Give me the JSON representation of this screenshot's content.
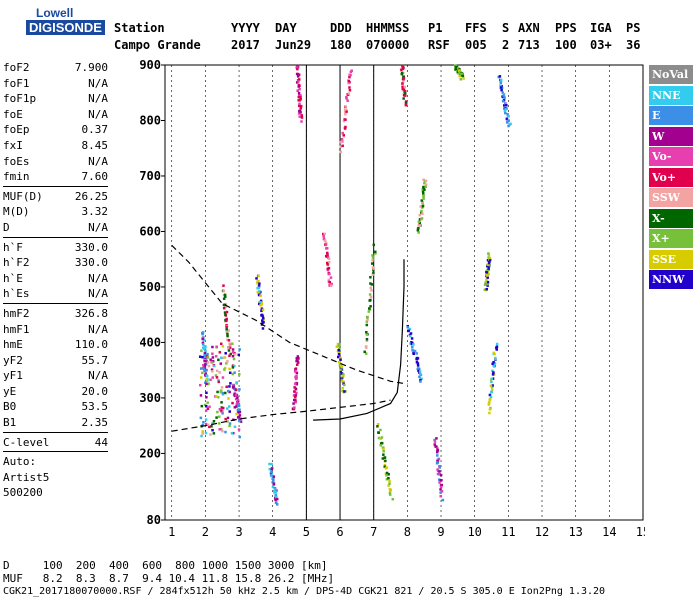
{
  "logo": {
    "line1": "Lowell",
    "line2": "DIGISONDE"
  },
  "header": {
    "row1": {
      "station": "Station",
      "yyyy": "YYYY",
      "day": "DAY",
      "ddd": "DDD",
      "hhmmss": "HHMMSS",
      "p1": "P1",
      "ffs": "FFS",
      "s": "S",
      "axn": "AXN",
      "pps": "PPS",
      "iga": "IGA",
      "ps": "PS"
    },
    "row2": {
      "station": "Campo Grande",
      "yyyy": "2017",
      "day": "Jun29",
      "ddd": "180",
      "hhmmss": "070000",
      "p1": "RSF",
      "ffs": "005",
      "s": "2",
      "axn": "713",
      "pps": "100",
      "iga": "03+",
      "ps": "36"
    }
  },
  "params": {
    "g1": [
      [
        "foF2",
        "7.900"
      ],
      [
        "foF1",
        "N/A"
      ],
      [
        "foF1p",
        "N/A"
      ],
      [
        "foE",
        "N/A"
      ],
      [
        "foEp",
        "0.37"
      ],
      [
        "fxI",
        "8.45"
      ],
      [
        "foEs",
        "N/A"
      ],
      [
        "fmin",
        "7.60"
      ]
    ],
    "g2": [
      [
        "MUF(D)",
        "26.25"
      ],
      [
        "M(D)",
        "3.32"
      ],
      [
        "D",
        "N/A"
      ]
    ],
    "g3": [
      [
        "h`F",
        "330.0"
      ],
      [
        "h`F2",
        "330.0"
      ],
      [
        "h`E",
        "N/A"
      ],
      [
        "h`Es",
        "N/A"
      ]
    ],
    "g4": [
      [
        "hmF2",
        "326.8"
      ],
      [
        "hmF1",
        "N/A"
      ],
      [
        "hmE",
        "110.0"
      ],
      [
        "yF2",
        "55.7"
      ],
      [
        "yF1",
        "N/A"
      ],
      [
        "yE",
        "20.0"
      ],
      [
        "B0",
        "53.5"
      ],
      [
        "B1",
        "2.35"
      ]
    ],
    "clevel": [
      "C-level",
      "44"
    ],
    "auto": [
      "Auto:",
      "Artist5",
      "500200"
    ]
  },
  "legend": [
    {
      "label": "NoVal",
      "color": "#8c8c8c"
    },
    {
      "label": "NNE",
      "color": "#33ccee"
    },
    {
      "label": "E",
      "color": "#3b8fe6"
    },
    {
      "label": "W",
      "color": "#a4008f"
    },
    {
      "label": "Vo-",
      "color": "#e83fb0"
    },
    {
      "label": "Vo+",
      "color": "#e0004d"
    },
    {
      "label": "SSW",
      "color": "#f4a3a3"
    },
    {
      "label": "X-",
      "color": "#006600"
    },
    {
      "label": "X+",
      "color": "#77c13a"
    },
    {
      "label": "SSE",
      "color": "#d6cc00"
    },
    {
      "label": "NNW",
      "color": "#2200cc"
    }
  ],
  "footer": {
    "row1": "D     100  200  400  600  800 1000 1500 3000 [km]",
    "row2": "MUF   8.2  8.3  8.7  9.4 10.4 11.8 15.8 26.2 [MHz]",
    "row3": "CGK21_2017180070000.RSF / 284fx512h 50 kHz 2.5 km / DPS-4D CGK21 821 / 20.5 S 305.0 E Ion2Png 1.3.20"
  },
  "chart_data": {
    "type": "scatter",
    "x_ticks": [
      1,
      2,
      3,
      4,
      5,
      6,
      7,
      8,
      9,
      10,
      11,
      12,
      13,
      14,
      15
    ],
    "y_ticks": [
      80,
      200,
      300,
      400,
      500,
      600,
      700,
      800,
      900
    ],
    "xlim": [
      0.8,
      15.0
    ],
    "ylim": [
      80,
      900
    ],
    "grid": "vertical dashed",
    "vertical_lines": [
      5.0,
      6.0,
      7.0
    ],
    "legend_position": "right",
    "profile_curve": {
      "x": [
        5.2,
        6.0,
        6.8,
        7.5,
        7.7,
        7.8,
        7.85,
        7.9,
        7.9
      ],
      "y": [
        260,
        262,
        272,
        290,
        310,
        360,
        420,
        500,
        550
      ]
    },
    "mufs_curve": {
      "x": [
        1.0,
        1.5,
        2.5,
        3.5,
        4.5,
        5.5,
        6.5,
        7.5,
        8.0
      ],
      "y": [
        575,
        545,
        470,
        440,
        400,
        375,
        350,
        330,
        325
      ]
    },
    "lower_dash_curve": {
      "x": [
        1.0,
        2.0,
        3.0,
        4.0,
        5.0,
        6.0,
        7.0,
        7.5
      ],
      "y": [
        240,
        250,
        262,
        270,
        276,
        283,
        290,
        296
      ]
    }
  }
}
